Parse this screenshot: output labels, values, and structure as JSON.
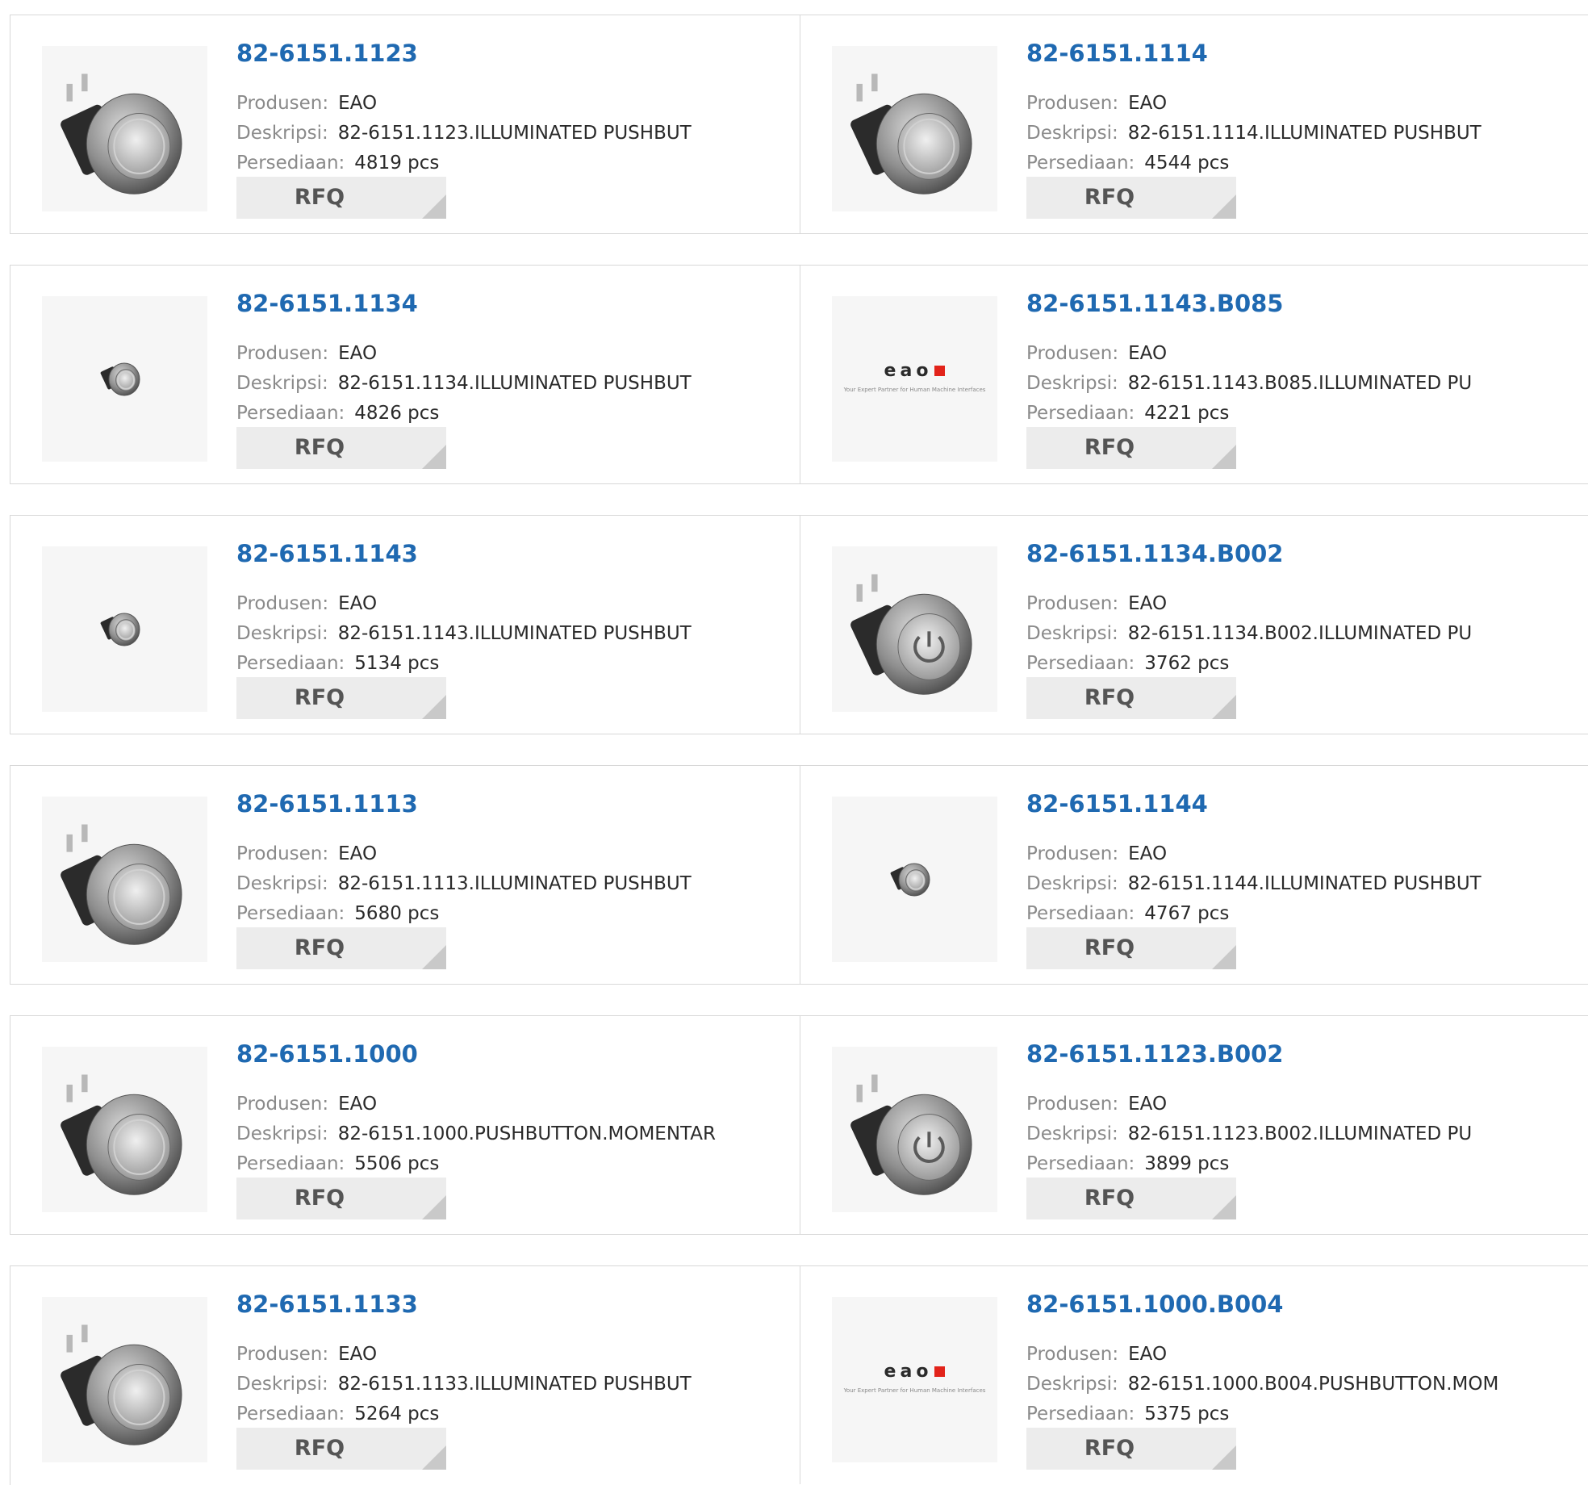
{
  "labels": {
    "manufacturer": "Produsen:",
    "description": "Deskripsi:",
    "stock": "Persediaan:",
    "rfq": "RFQ"
  },
  "colors": {
    "title": "#1f69b1",
    "label": "#8a8a8a",
    "value": "#2a2a2a",
    "button_bg": "#ececec",
    "button_corner": "#c9c9c9",
    "border": "#d8d8d8",
    "eao_red": "#e2231a"
  },
  "products": [
    {
      "part": "82-6151.1123",
      "manufacturer": "EAO",
      "description": "82-6151.1123.ILLUMINATED PUSHBUT",
      "stock": "4819 pcs",
      "image": "pushbutton-large-icon"
    },
    {
      "part": "82-6151.1114",
      "manufacturer": "EAO",
      "description": "82-6151.1114.ILLUMINATED PUSHBUT",
      "stock": "4544 pcs",
      "image": "pushbutton-side-icon"
    },
    {
      "part": "82-6151.1134",
      "manufacturer": "EAO",
      "description": "82-6151.1134.ILLUMINATED PUSHBUT",
      "stock": "4826 pcs",
      "image": "pushbutton-small-icon"
    },
    {
      "part": "82-6151.1143.B085",
      "manufacturer": "EAO",
      "description": "82-6151.1143.B085.ILLUMINATED PU",
      "stock": "4221 pcs",
      "image": "eao-logo",
      "logo_text": "eao",
      "logo_tagline": "Your Expert Partner for Human Machine Interfaces"
    },
    {
      "part": "82-6151.1143",
      "manufacturer": "EAO",
      "description": "82-6151.1143.ILLUMINATED PUSHBUT",
      "stock": "5134 pcs",
      "image": "pushbutton-small-icon"
    },
    {
      "part": "82-6151.1134.B002",
      "manufacturer": "EAO",
      "description": "82-6151.1134.B002.ILLUMINATED PU",
      "stock": "3762 pcs",
      "image": "pushbutton-power-icon"
    },
    {
      "part": "82-6151.1113",
      "manufacturer": "EAO",
      "description": "82-6151.1113.ILLUMINATED PUSHBUT",
      "stock": "5680 pcs",
      "image": "pushbutton-large-icon"
    },
    {
      "part": "82-6151.1144",
      "manufacturer": "EAO",
      "description": "82-6151.1144.ILLUMINATED PUSHBUT",
      "stock": "4767 pcs",
      "image": "pushbutton-small-icon"
    },
    {
      "part": "82-6151.1000",
      "manufacturer": "EAO",
      "description": "82-6151.1000.PUSHBUTTON.MOMENTAR",
      "stock": "5506 pcs",
      "image": "pushbutton-large-icon"
    },
    {
      "part": "82-6151.1123.B002",
      "manufacturer": "EAO",
      "description": "82-6151.1123.B002.ILLUMINATED PU",
      "stock": "3899 pcs",
      "image": "pushbutton-power-icon"
    },
    {
      "part": "82-6151.1133",
      "manufacturer": "EAO",
      "description": "82-6151.1133.ILLUMINATED PUSHBUT",
      "stock": "5264 pcs",
      "image": "pushbutton-large-icon"
    },
    {
      "part": "82-6151.1000.B004",
      "manufacturer": "EAO",
      "description": "82-6151.1000.B004.PUSHBUTTON.MOM",
      "stock": "5375 pcs",
      "image": "eao-logo",
      "logo_text": "eao",
      "logo_tagline": "Your Expert Partner for Human Machine Interfaces"
    }
  ]
}
